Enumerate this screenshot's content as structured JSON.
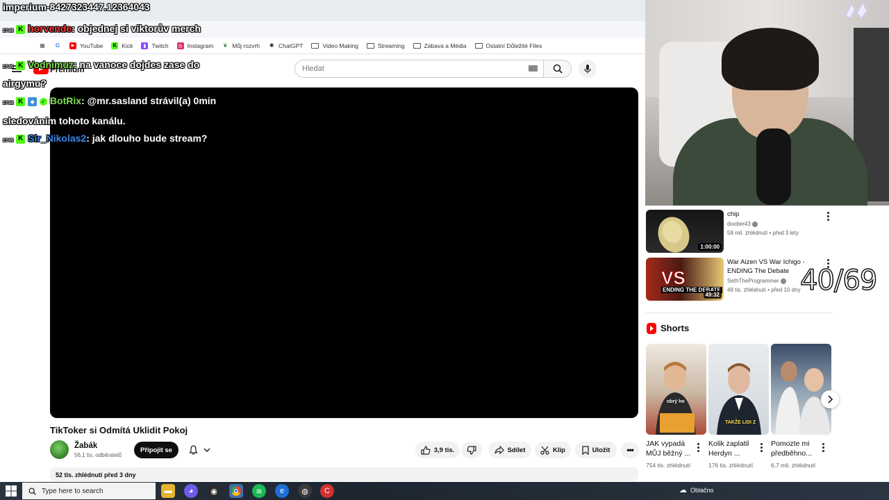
{
  "bookmarks": [
    {
      "label": "YouTube",
      "icon": "youtube-icon",
      "color": "#ff0000"
    },
    {
      "label": "Kick",
      "icon": "kick-icon",
      "color": "#53fc18"
    },
    {
      "label": "Twitch",
      "icon": "twitch-icon",
      "color": "#9146ff"
    },
    {
      "label": "Instagram",
      "icon": "instagram-icon",
      "color": "#e1306c"
    },
    {
      "label": "Můj rozvrh",
      "icon": "leaf-icon",
      "color": "#2e7d32"
    },
    {
      "label": "ChatGPT",
      "icon": "chatgpt-icon",
      "color": "#222222"
    },
    {
      "label": "Video Making",
      "icon": "folder-icon"
    },
    {
      "label": "Streaming",
      "icon": "folder-icon"
    },
    {
      "label": "Zábava a Média",
      "icon": "folder-icon"
    },
    {
      "label": "Ostatní Důležité Files",
      "icon": "folder-icon"
    }
  ],
  "youtube": {
    "logo_text": "Premium",
    "search_placeholder": "Hledat"
  },
  "video": {
    "title": "TikToker si Odmítá Uklidit Pokoj",
    "channel": "Žabák",
    "subscribers": "56,1 tis. odběratelů",
    "join_label": "Připojit se",
    "likes": "3,9 tis.",
    "share_label": "Sdílet",
    "clip_label": "Klip",
    "save_label": "Uložit",
    "description_meta": "52 tis. zhlédnutí  před 3 dny"
  },
  "recommendations": [
    {
      "title": "chip",
      "channel": "doober43",
      "meta": "58 mil. zhlédnutí • před 3 lety",
      "duration": "1:00:00"
    },
    {
      "title": "War Aizen VS War Ichigo - ENDING The Debate",
      "channel": "SethTheProgrammer",
      "meta": "48 tis. zhlédnutí • před 10 dny",
      "duration": "49:32",
      "thumb_text": "ENDING THE DEBATE"
    }
  ],
  "shorts": {
    "heading": "Shorts",
    "items": [
      {
        "title": "JAK vypadá MŮJ běžný ...",
        "views": "754 tis. zhlédnutí",
        "caption": "obrý ho"
      },
      {
        "title": "Kolik zaplatil Herdyn ...",
        "views": "176 tis. zhlédnutí",
        "caption": "TAKŽE LIDI Z"
      },
      {
        "title": "Pomozte mi předběhno...",
        "views": "6,7 mil. zhlédnutí"
      }
    ]
  },
  "overlay": {
    "counter": "40/69",
    "header": "imperium-8427323447.12364043",
    "chat": [
      {
        "time": "17:05",
        "user": "horvende",
        "user_color": "#ff3c3c",
        "text": ": objednej si viktorův merch"
      },
      {
        "time": "17:05",
        "user": "Vodnimuz",
        "user_color": "#7fe04f",
        "text": ": na vanoce dojdes zase do airgymu?"
      },
      {
        "time": "17:05",
        "user": "BotRix",
        "user_color": "#7fe04f",
        "text": ": @mr.sasland strávil(a) 0min sledováním tohoto kanálu."
      },
      {
        "time": "17:05",
        "user": "Sir_Nikolas2",
        "user_color": "#3a86e8",
        "text": ": jak dlouho bude stream?"
      }
    ]
  },
  "taskbar": {
    "search_placeholder": "Type here to search",
    "weather": "Oblačno"
  }
}
